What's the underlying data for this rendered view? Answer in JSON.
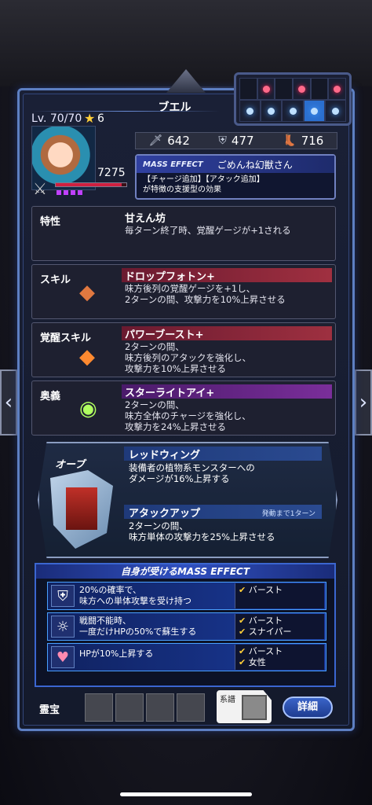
{
  "unit": {
    "name": "ブエル",
    "level": "Lv. 70/70",
    "stars": "6",
    "hp": "7275",
    "hp_fill": 0.93
  },
  "stats": {
    "attack": "642",
    "defense": "477",
    "speed": "716"
  },
  "mass_effect": {
    "tag": "MASS EFFECT",
    "name": "ごめんね幻獣さん",
    "desc_line1": "【チャージ追加】【アタック追加】",
    "desc_line2": "が特徴の支援型の効果"
  },
  "tokusei": {
    "label": "特性",
    "title": "甘えん坊",
    "desc": "毎ターン終了時、覚醒ゲージが+1される"
  },
  "skill": {
    "label": "スキル",
    "title": "ドロップフォトン+",
    "desc1": "味方後列の覚醒ゲージを+1し、",
    "desc2": "2ターンの間、攻撃力を10%上昇させる"
  },
  "awakening": {
    "label": "覚醒スキル",
    "title": "パワーブースト+",
    "desc1": "2ターンの間、",
    "desc2": "味方後列のアタックを強化し、",
    "desc3": "攻撃力を10%上昇させる"
  },
  "ougi": {
    "label": "奥義",
    "title": "スターライトアイ+",
    "desc1": "2ターンの間、",
    "desc2": "味方全体のチャージを強化し、",
    "desc3": "攻撃力を24%上昇させる"
  },
  "orb": {
    "label": "オーブ",
    "title1": "レッドウィング",
    "desc1a": "装備者の植物系モンスターへの",
    "desc1b": "ダメージが16%上昇する",
    "title2": "アタックアップ",
    "countdown": "発動まで1ターン",
    "desc2a": "2ターンの間、",
    "desc2b": "味方単体の攻撃力を25%上昇させる"
  },
  "mass_list": {
    "header": "自身が受けるMASS EFFECT",
    "rows": [
      {
        "icon": "shield-icon",
        "l1": "20%の確率で、",
        "l2": "味方への単体攻撃を受け持つ",
        "t1": "バースト",
        "t2": ""
      },
      {
        "icon": "halo-icon",
        "l1": "戦闘不能時、",
        "l2": "一度だけHPの50%で蘇生する",
        "t1": "バースト",
        "t2": "スナイパー"
      },
      {
        "icon": "heart-icon",
        "l1": "HPが10%上昇する",
        "l2": "",
        "t1": "バースト",
        "t2": "女性"
      }
    ]
  },
  "footer": {
    "reiho": "霊宝",
    "keifu": "系譜",
    "detail": "詳細"
  }
}
